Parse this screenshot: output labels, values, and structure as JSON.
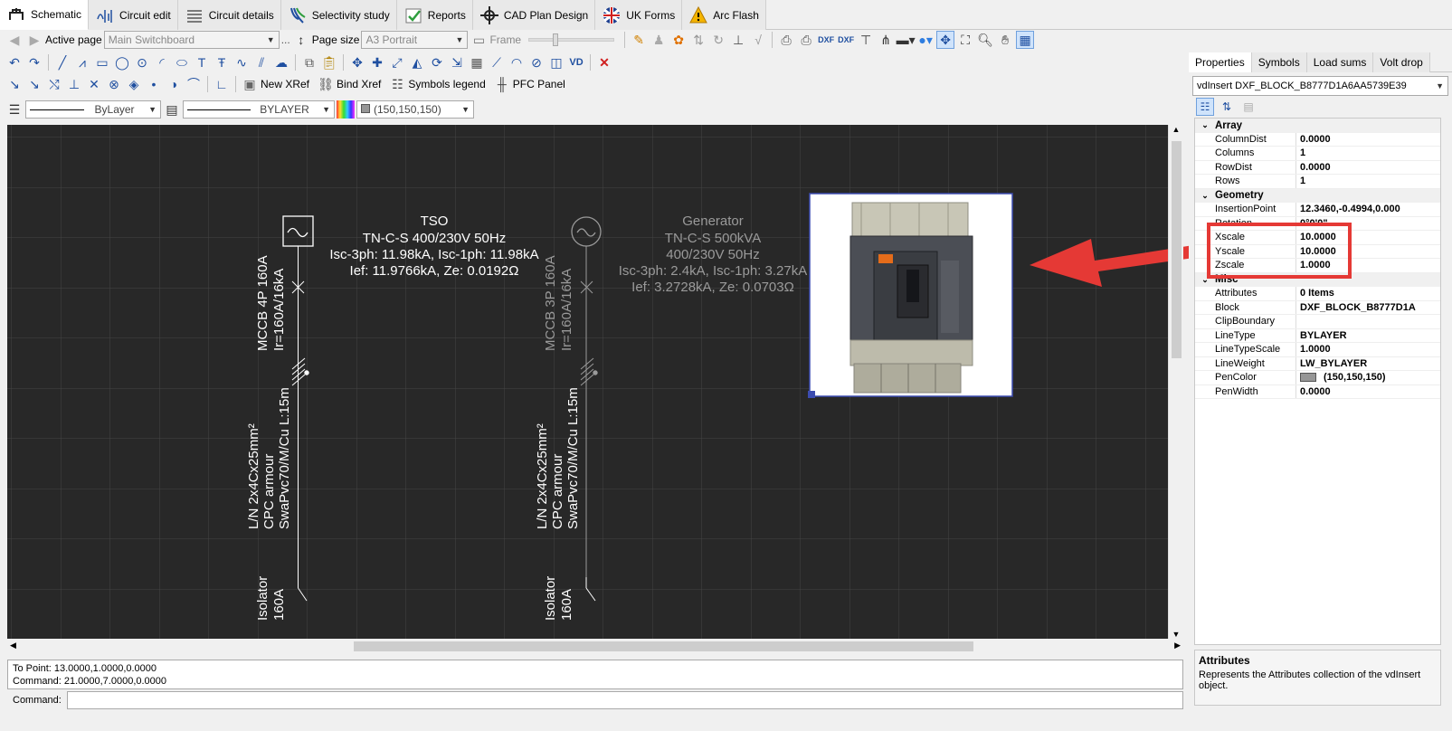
{
  "tabs": [
    {
      "label": "Schematic",
      "icon": "schematic-icon",
      "active": true
    },
    {
      "label": "Circuit edit",
      "icon": "circuit-edit-icon"
    },
    {
      "label": "Circuit details",
      "icon": "circuit-details-icon"
    },
    {
      "label": "Selectivity study",
      "icon": "selectivity-icon"
    },
    {
      "label": "Reports",
      "icon": "reports-icon"
    },
    {
      "label": "CAD Plan Design",
      "icon": "cad-plan-icon"
    },
    {
      "label": "UK Forms",
      "icon": "uk-flag-icon"
    },
    {
      "label": "Arc Flash",
      "icon": "warning-icon"
    }
  ],
  "toolbar1": {
    "active_page_label": "Active page",
    "active_page_value": "Main Switchboard",
    "page_size_label": "Page size",
    "page_size_value": "A3 Portrait",
    "frame_label": "Frame",
    "ellipsis": "..."
  },
  "toolbar3": {
    "new_xref": "New XRef",
    "bind_xref": "Bind Xref",
    "symbols_legend": "Symbols legend",
    "pfc_panel": "PFC Panel"
  },
  "toolbar4": {
    "linetype_value": "ByLayer",
    "lineweight_value": "BYLAYER",
    "color_value": "(150,150,150)"
  },
  "drawing": {
    "source1": {
      "title": "TSO",
      "line1": "TN-C-S 400/230V 50Hz",
      "line2": "Isc-3ph: 11.98kA, Isc-1ph: 11.98kA",
      "line3": "Ief: 11.9766kA, Ze: 0.0192Ω"
    },
    "source2": {
      "title": "Generator",
      "line1": "TN-C-S 500kVA",
      "line2": "400/230V 50Hz",
      "line3": "Isc-3ph: 2.4kA, Isc-1ph: 3.27kA",
      "line4": "Ief: 3.2728kA, Ze: 0.0703Ω"
    },
    "breaker1": {
      "line1": "MCCB 4P 160A",
      "line2": "Ir=160A/16kA"
    },
    "breaker2": {
      "line1": "MCCB 3P 160A",
      "line2": "Ir=160A/16kA"
    },
    "cable1": {
      "line1": "L/N 2x4Cx25mm²",
      "line2": "CPC armour",
      "line3": "SwaPvc70/M/Cu L:15m"
    },
    "cable2": {
      "line1": "L/N 2x4Cx25mm²",
      "line2": "CPC armour",
      "line3": "SwaPvc70/M/Cu L:15m"
    },
    "isolator1": {
      "line1": "Isolator",
      "line2": "160A"
    },
    "isolator2": {
      "line1": "Isolator",
      "line2": "160A"
    }
  },
  "command": {
    "history1": "To Point: 13.0000,1.0000,0.0000",
    "history2": "Command: 21.0000,7.0000,0.0000",
    "label": "Command:"
  },
  "right_panel": {
    "tabs": [
      "Properties",
      "Symbols",
      "Load sums",
      "Volt drop"
    ],
    "object": "vdInsert DXF_BLOCK_B8777D1A6AA5739E39",
    "categories": [
      {
        "name": "Array",
        "rows": [
          [
            "ColumnDist",
            "0.0000"
          ],
          [
            "Columns",
            "1"
          ],
          [
            "RowDist",
            "0.0000"
          ],
          [
            "Rows",
            "1"
          ]
        ]
      },
      {
        "name": "Geometry",
        "rows": [
          [
            "InsertionPoint",
            "12.3460,-0.4994,0.000"
          ],
          [
            "Rotation",
            "0°0'0\""
          ],
          [
            "Xscale",
            "10.0000"
          ],
          [
            "Yscale",
            "10.0000"
          ],
          [
            "Zscale",
            "1.0000"
          ]
        ]
      },
      {
        "name": "Misc",
        "rows": [
          [
            "Attributes",
            "0 Items"
          ],
          [
            "Block",
            "DXF_BLOCK_B8777D1A"
          ],
          [
            "ClipBoundary",
            ""
          ],
          [
            "LineType",
            "BYLAYER"
          ],
          [
            "LineTypeScale",
            "1.0000"
          ],
          [
            "LineWeight",
            "LW_BYLAYER"
          ],
          [
            "PenColor",
            "(150,150,150)"
          ],
          [
            "PenWidth",
            "0.0000"
          ]
        ]
      }
    ],
    "desc_title": "Attributes",
    "desc_text": "Represents the Attributes collection of the vdInsert object."
  },
  "colors": {
    "canvas": "#282828",
    "grid": "#454545",
    "highlight": "#e53935",
    "selection": "#3c4cb0"
  }
}
